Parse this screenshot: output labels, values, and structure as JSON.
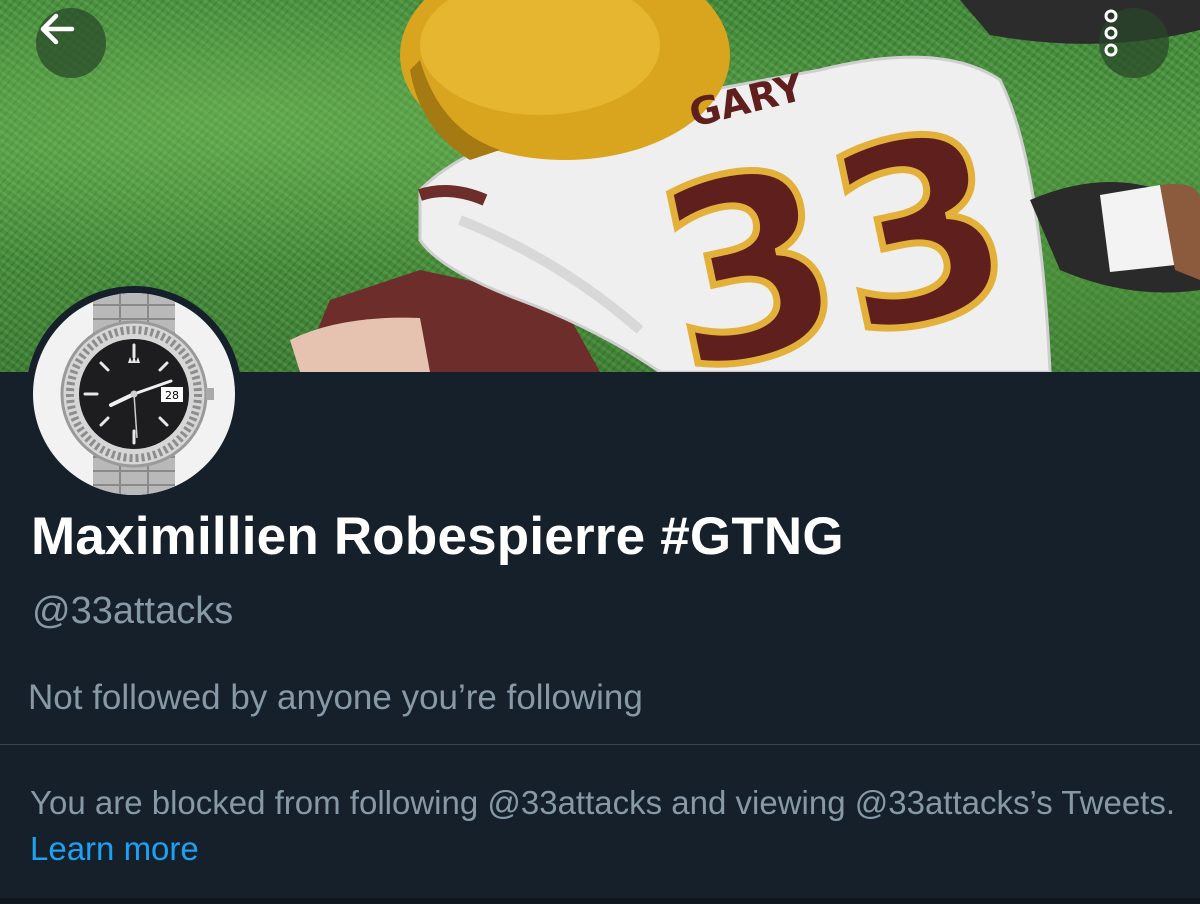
{
  "banner": {
    "jersey_name": "GARY",
    "jersey_number": "33"
  },
  "avatar": {
    "date_window": "28"
  },
  "profile": {
    "display_name": "Maximillien Robespierre #GTNG",
    "handle": "@33attacks",
    "followers_note": "Not followed by anyone you’re following"
  },
  "blocked": {
    "message": "You are blocked from following @33attacks and viewing @33attacks’s Tweets.",
    "learn_more": "Learn more"
  },
  "icons": {
    "back": "arrow-left-icon",
    "more": "more-vertical-icon"
  },
  "colors": {
    "background": "#15202b",
    "secondary_text": "#8899a6",
    "link": "#1da1f2",
    "divider": "#38444d"
  }
}
